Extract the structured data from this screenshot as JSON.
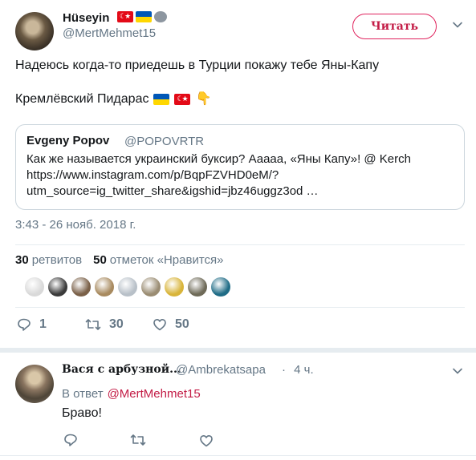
{
  "tweet": {
    "author_name": "Hüseyin",
    "author_handle": "@MertMehmet15",
    "follow_label": "Читать",
    "text_line1": "Надеюсь когда-то приедешь в Турции покажу тебе Яны-Капу",
    "text_line2": "Кремлёвский Пидарас",
    "quote": {
      "name": "Evgeny Popov",
      "handle": "@POPOVRTR",
      "text": "Как же называется украинский буксир? Ааааа, «Яны Капу»! @ Kerch https://www.instagram.com/p/BqpFZVHD0eM/?utm_source=ig_twitter_share&igshid=jbz46uggz3od …"
    },
    "timestamp": "3:43 - 26 нояб. 2018 г.",
    "stats": {
      "retweets_count": "30",
      "retweets_label": "ретвитов",
      "likes_count": "50",
      "likes_label": "отметок «Нравится»"
    },
    "likers": [
      "#d9d9d9",
      "#3b3b3b",
      "#7a6048",
      "#a88a5f",
      "#b8c0c8",
      "#9a8c72",
      "#d8b43a",
      "#6e6a58",
      "#1f6c86"
    ],
    "actions": {
      "reply_count": "1",
      "retweet_count": "30",
      "like_count": "50"
    },
    "icons": {
      "reply": "reply-bubble-icon",
      "retweet": "retweet-icon",
      "like": "heart-icon",
      "more": "chevron-down-icon"
    },
    "accent_color": "#e0245e",
    "muted_color": "#657786"
  },
  "reply": {
    "author_name": "Вася с арбузной...",
    "author_handle": "@Ambrekatsapa",
    "separator": "·",
    "time": "4 ч.",
    "reply_prefix": "В ответ",
    "reply_to_handle": "@MertMehmet15",
    "text": "Браво!"
  }
}
